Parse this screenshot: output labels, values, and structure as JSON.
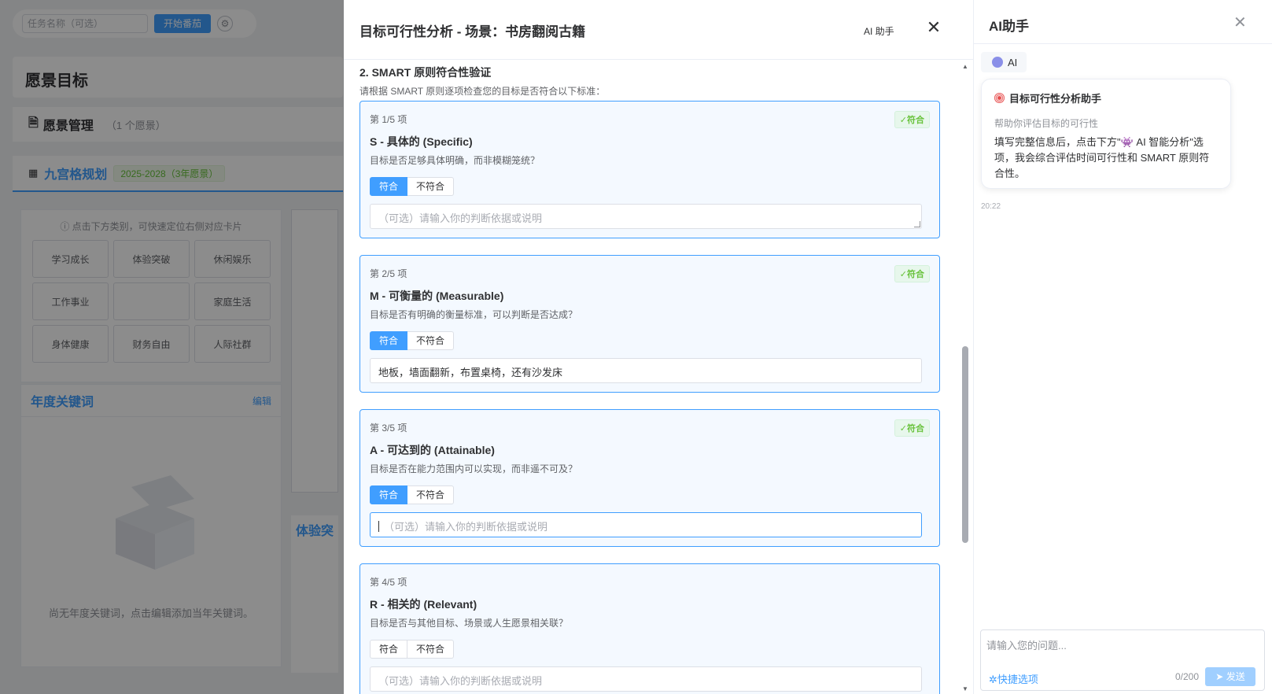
{
  "background": {
    "task_placeholder": "任务名称（可选）",
    "start_button": "开始番茄",
    "gear_icon": "gear-icon",
    "vision_title": "愿景目标",
    "vision_manage": "愿景管理",
    "vision_count": "（1 个愿景）",
    "grid_title": "九宫格规划",
    "grid_range": "2025-2028（3年愿景）",
    "grid_hint": "点击下方类别，可快速定位右侧对应卡片",
    "categories": [
      "学习成长",
      "体验突破",
      "休闲娱乐",
      "工作事业",
      "",
      "家庭生活",
      "身体健康",
      "财务自由",
      "人际社群"
    ],
    "keyword_title": "年度关键词",
    "keyword_edit": "编辑",
    "keyword_empty": "尚无年度关键词，点击编辑添加当年关键词。",
    "mid_title": "体验突"
  },
  "drawer": {
    "title": "目标可行性分析 - 场景：书房翻阅古籍",
    "ai_link": "AI 助手",
    "section_title": "2. SMART 原则符合性验证",
    "section_desc": "请根据 SMART 原则逐项检查您的目标是否符合以下标准：",
    "items": [
      {
        "no": "第 1/5 项",
        "badge": "✓符合",
        "name": "S - 具体的 (Specific)",
        "question": "目标是否足够具体明确，而非模糊笼统？",
        "yes": "符合",
        "no_label": "不符合",
        "selected": "yes",
        "note": "",
        "placeholder": "（可选）请输入你的判断依据或说明"
      },
      {
        "no": "第 2/5 项",
        "badge": "✓符合",
        "name": "M - 可衡量的 (Measurable)",
        "question": "目标是否有明确的衡量标准，可以判断是否达成？",
        "yes": "符合",
        "no_label": "不符合",
        "selected": "yes",
        "note": "地板，墙面翻新，布置桌椅，还有沙发床",
        "placeholder": "（可选）请输入你的判断依据或说明"
      },
      {
        "no": "第 3/5 项",
        "badge": "✓符合",
        "name": "A - 可达到的 (Attainable)",
        "question": "目标是否在能力范围内可以实现，而非遥不可及？",
        "yes": "符合",
        "no_label": "不符合",
        "selected": "yes",
        "note": "",
        "placeholder": "（可选）请输入你的判断依据或说明"
      },
      {
        "no": "第 4/5 项",
        "badge": "",
        "name": "R - 相关的 (Relevant)",
        "question": "目标是否与其他目标、场景或人生愿景相关联？",
        "yes": "符合",
        "no_label": "不符合",
        "selected": "",
        "note": "",
        "placeholder": "（可选）请输入你的判断依据或说明"
      }
    ]
  },
  "ai_panel": {
    "title": "AI助手",
    "tag": "AI",
    "bubble_title": "目标可行性分析助手",
    "bubble_sub": "帮助你评估目标的可行性",
    "bubble_body": "填写完整信息后，点击下方\"👾 AI 智能分析\"选项，我会综合评估时间可行性和 SMART 原则符合性。",
    "time": "20:22",
    "input_placeholder": "请输入您的问题...",
    "quick": "快捷选项",
    "count": "0/200",
    "send": "发送"
  },
  "colors": {
    "primary": "#409eff",
    "success": "#67c23a",
    "mask": "rgba(0,0,0,0.45)"
  }
}
